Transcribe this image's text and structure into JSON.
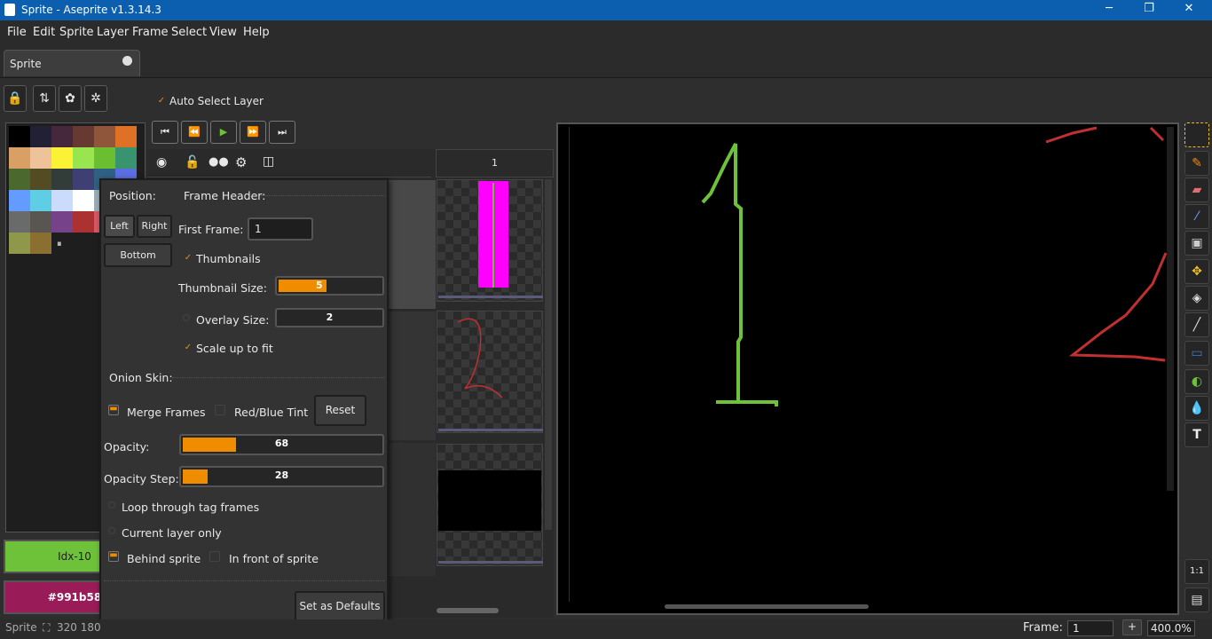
{
  "window": {
    "title": "Sprite - Aseprite v1.3.14.3",
    "minimize": "─",
    "maximize": "❐",
    "close": "✕"
  },
  "menu": [
    "File",
    "Edit",
    "Sprite",
    "Layer",
    "Frame",
    "Select",
    "View",
    "Help"
  ],
  "tab": {
    "label": "Sprite"
  },
  "toolbar": {
    "auto_select_layer": "Auto Select Layer"
  },
  "timeline": {
    "frame_number": "1"
  },
  "colors": {
    "fg_label": "Idx-10",
    "bg_label": "#991b58",
    "fg": "#6ec23a",
    "bg": "#991b58",
    "accent": "#f08c00"
  },
  "palette": [
    "#000000",
    "#222034",
    "#45283c",
    "#663931",
    "#8f563b",
    "#df7126",
    "#d9a066",
    "#eec39a",
    "#fbf236",
    "#99e550",
    "#6abe30",
    "#37946e",
    "#4b692f",
    "#524b24",
    "#323c39",
    "#3f3f74",
    "#306082",
    "#5b6ee1",
    "#639bff",
    "#5fcde4",
    "#cbdbfc",
    "#ffffff",
    "#9badb7",
    "#847e87",
    "#696a6a",
    "#595652",
    "#76428a",
    "#ac3232",
    "#d95763",
    "#d77bba",
    "#8f974a",
    "#8a6f30"
  ],
  "popup": {
    "position_header": "Position:",
    "frame_header": "Frame Header:",
    "left": "Left",
    "right": "Right",
    "bottom": "Bottom",
    "first_frame_label": "First Frame:",
    "first_frame_value": "1",
    "thumbnails": "Thumbnails",
    "thumbnail_size_label": "Thumbnail Size:",
    "thumbnail_size": "5",
    "overlay_size_label": "Overlay Size:",
    "overlay_size": "2",
    "scale_up": "Scale up to fit",
    "onion_header": "Onion Skin:",
    "merge_frames": "Merge Frames",
    "red_blue_tint": "Red/Blue Tint",
    "reset": "Reset",
    "opacity_label": "Opacity:",
    "opacity": "68",
    "opacity_step_label": "Opacity Step:",
    "opacity_step": "28",
    "loop_tag": "Loop through tag frames",
    "current_layer": "Current layer only",
    "behind_sprite": "Behind sprite",
    "in_front": "In front of sprite",
    "set_defaults": "Set as Defaults"
  },
  "status": {
    "sprite": "Sprite",
    "size": "320 180",
    "frame_label": "Frame:",
    "frame_value": "1",
    "plus": "+",
    "zoom": "400.0%"
  }
}
